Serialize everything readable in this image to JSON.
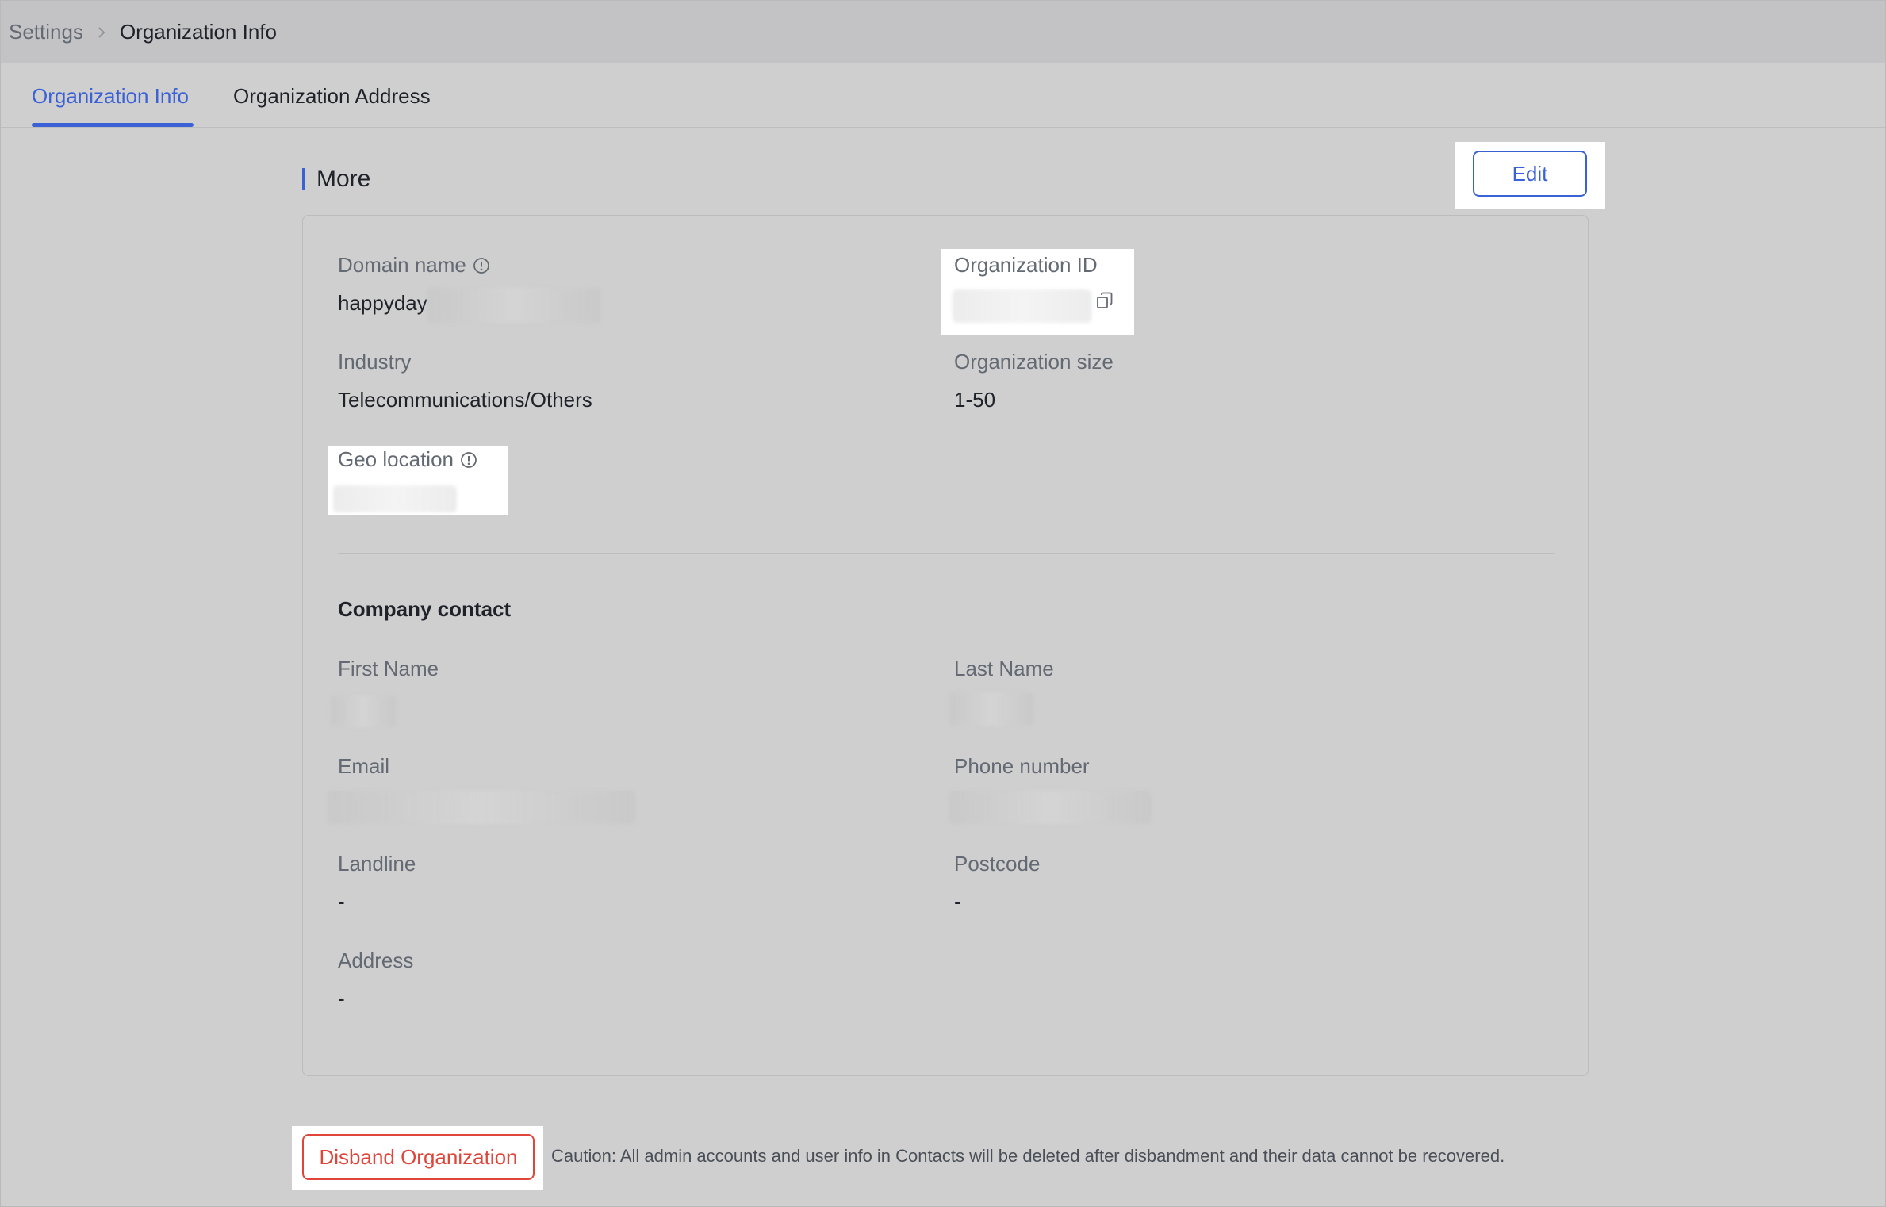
{
  "breadcrumb": {
    "parent": "Settings",
    "current": "Organization Info"
  },
  "tabs": [
    {
      "label": "Organization Info",
      "active": true
    },
    {
      "label": "Organization Address",
      "active": false
    }
  ],
  "section": {
    "title": "More",
    "edit_label": "Edit"
  },
  "org": {
    "domain_label": "Domain name",
    "domain_value": "happyday",
    "org_id_label": "Organization ID",
    "industry_label": "Industry",
    "industry_value": "Telecommunications/Others",
    "size_label": "Organization size",
    "size_value": "1-50",
    "geo_label": "Geo location"
  },
  "contact": {
    "title": "Company contact",
    "first_name_label": "First Name",
    "last_name_label": "Last Name",
    "email_label": "Email",
    "phone_label": "Phone number",
    "landline_label": "Landline",
    "landline_value": "-",
    "postcode_label": "Postcode",
    "postcode_value": "-",
    "address_label": "Address",
    "address_value": "-"
  },
  "footer": {
    "disband_label": "Disband Organization",
    "caution_text": "Caution: All admin accounts and user info in Contacts will be deleted after disbandment and their data cannot be recovered."
  },
  "colors": {
    "accent": "#3a62d6",
    "danger": "#e0453a",
    "topbar": "#c3c3c5",
    "background": "#cfcfcf"
  },
  "icons": [
    "chevron-right-icon",
    "info-icon",
    "copy-icon"
  ]
}
